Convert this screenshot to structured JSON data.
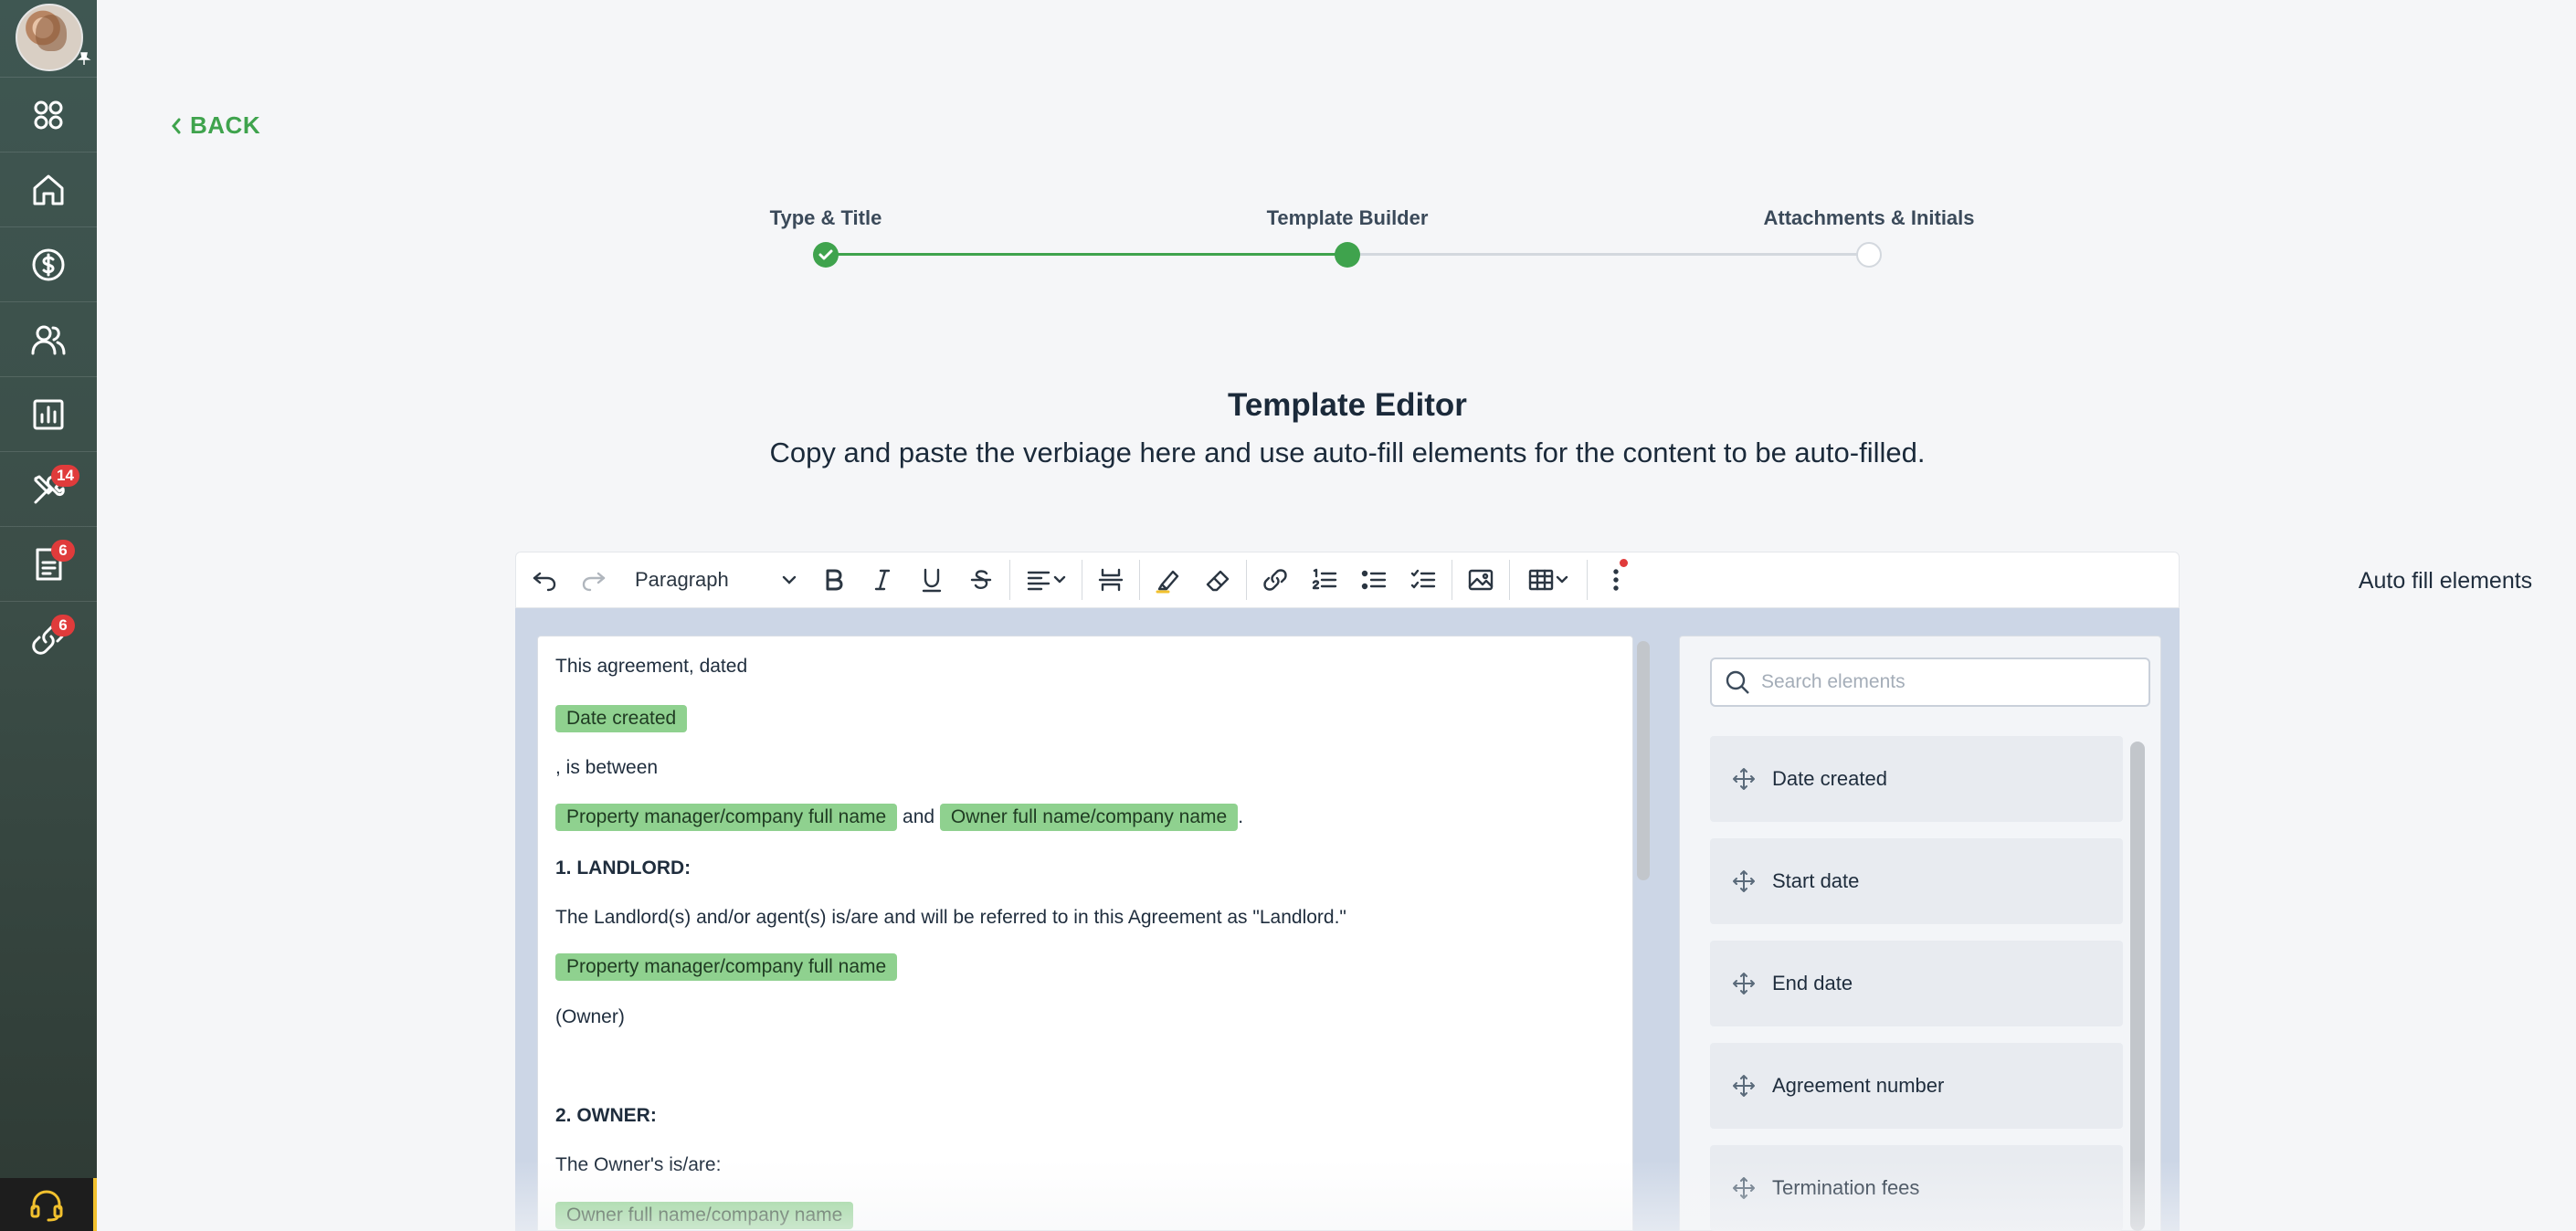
{
  "sidebar": {
    "items": [
      {
        "name": "apps",
        "badge": ""
      },
      {
        "name": "home",
        "badge": ""
      },
      {
        "name": "finance",
        "badge": ""
      },
      {
        "name": "contacts",
        "badge": ""
      },
      {
        "name": "reports",
        "badge": ""
      },
      {
        "name": "maintenance",
        "badge": "14"
      },
      {
        "name": "documents",
        "badge": "6"
      },
      {
        "name": "links",
        "badge": "6"
      }
    ]
  },
  "back_label": "BACK",
  "stepper": {
    "steps": [
      {
        "label": "Type & Title",
        "state": "complete"
      },
      {
        "label": "Template Builder",
        "state": "current"
      },
      {
        "label": "Attachments & Initials",
        "state": "pending"
      }
    ],
    "accent": "#3fa34d"
  },
  "editor": {
    "title": "Template Editor",
    "subtitle": "Copy and paste the verbiage here and use auto-fill elements for the content to be auto-filled.",
    "paragraph_style": "Paragraph",
    "content": {
      "line1": "This agreement, dated",
      "chip_date_created": "Date created",
      "line3": ", is between",
      "chip_pm_name": "Property manager/company full name",
      "and": "and",
      "chip_owner_name": "Owner full name/company name",
      "period": ".",
      "heading1": "1. LANDLORD:",
      "landlord_text": "The Landlord(s) and/or agent(s) is/are and will be referred to in this Agreement as \"Landlord.\"",
      "chip_pm_name2": "Property manager/company full name",
      "owner_paren": "(Owner)",
      "heading2": "2. OWNER:",
      "owner_text": "The Owner's is/are:",
      "chip_owner_name2": "Owner full name/company name"
    }
  },
  "autofill": {
    "title": "Auto fill elements",
    "search_placeholder": "Search elements",
    "items": [
      "Date created",
      "Start date",
      "End date",
      "Agreement number",
      "Termination fees"
    ]
  }
}
